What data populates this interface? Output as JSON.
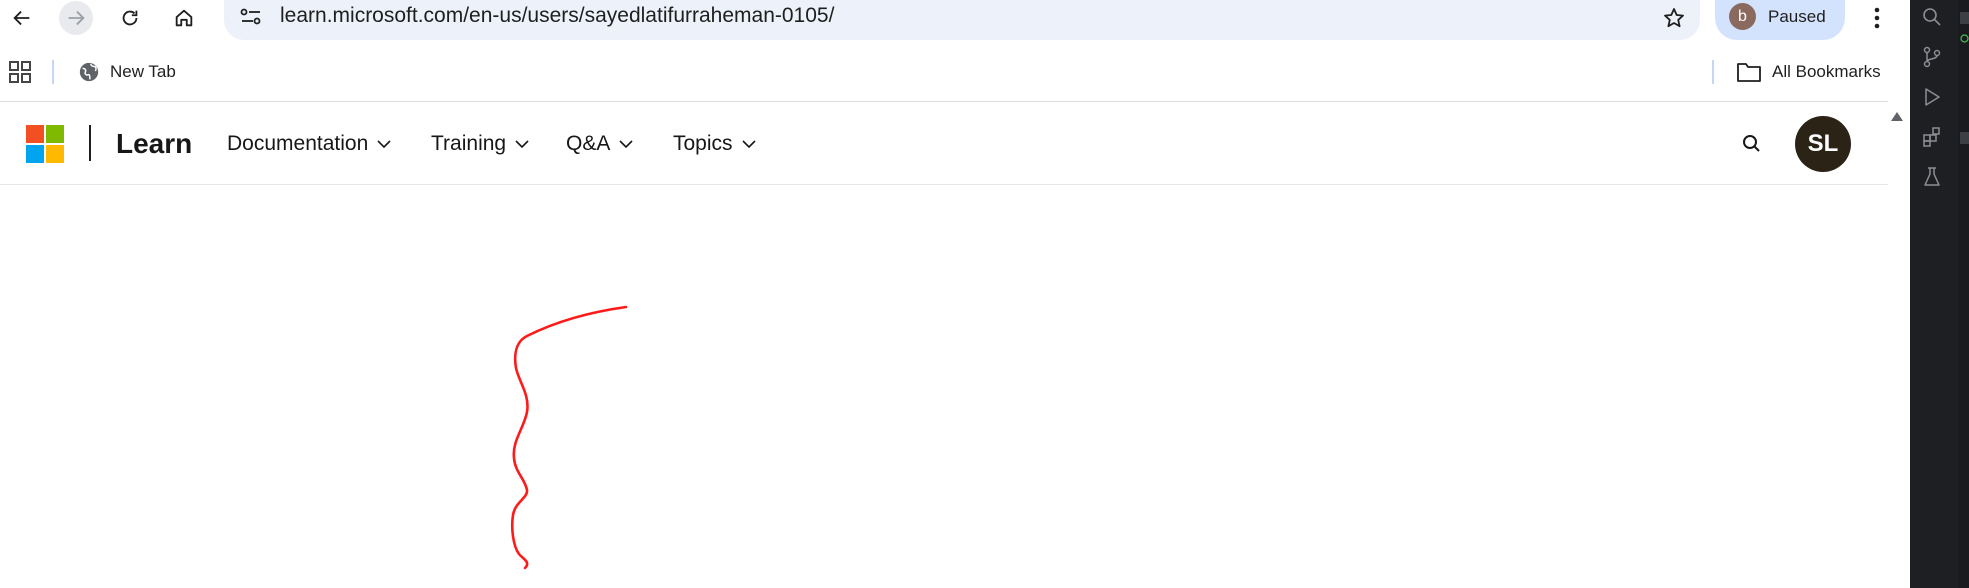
{
  "browser": {
    "url": "learn.microsoft.com/en-us/users/sayedlatifurraheman-0105/",
    "profile": {
      "initial": "b",
      "status": "Paused"
    }
  },
  "bookmarks": {
    "items": [
      {
        "label": "New Tab",
        "icon": "globe-icon"
      }
    ],
    "all_bookmarks": "All Bookmarks"
  },
  "site": {
    "brand": "Learn",
    "menu": [
      {
        "label": "Documentation"
      },
      {
        "label": "Training"
      },
      {
        "label": "Q&A"
      },
      {
        "label": "Topics"
      }
    ],
    "user_initials": "SL"
  },
  "colors": {
    "ms_red": "#f25022",
    "ms_green": "#7fba00",
    "ms_blue": "#00a4ef",
    "ms_yellow": "#ffb900",
    "annotation": "#ff0000"
  }
}
